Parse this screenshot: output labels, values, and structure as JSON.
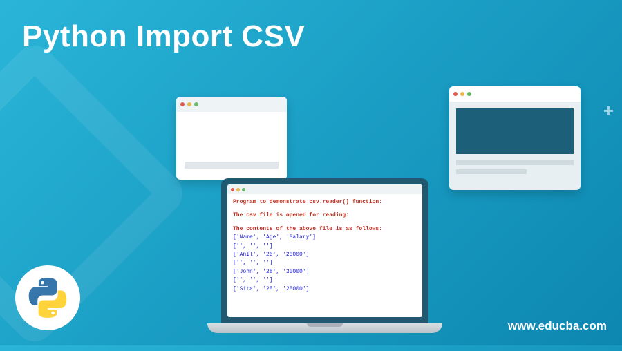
{
  "title": "Python Import CSV",
  "website": "www.educba.com",
  "terminal": {
    "line1": "Program to demonstrate csv.reader() function:",
    "line2": "The csv file is opened for reading:",
    "line3": "The contents of the above file is as follows:",
    "rows": [
      "['Name', 'Age', 'Salary']",
      "['', '', '']",
      "['Anil', '26', '20000']",
      "['', '', '']",
      "['John', '28', '30000']",
      "['', '', '']",
      "['Sita', '25', '25000']"
    ]
  },
  "colors": {
    "dot_red": "#e05a4f",
    "dot_yellow": "#e8b84a",
    "dot_green": "#6ab96a"
  }
}
